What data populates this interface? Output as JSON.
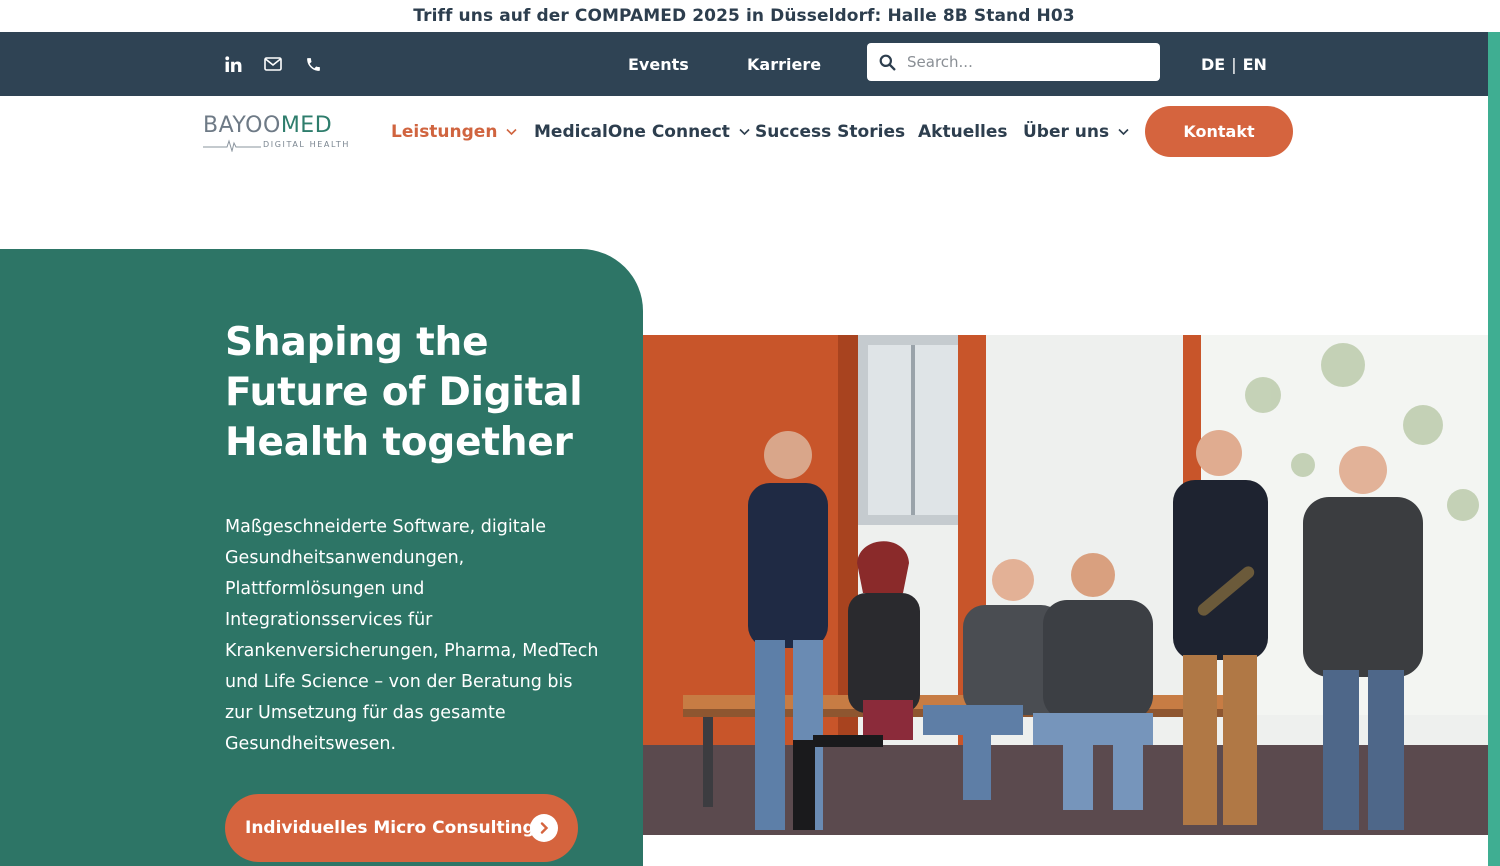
{
  "announcement": "Triff uns auf der COMPAMED 2025 in Düsseldorf: Halle 8B Stand H03",
  "topbar": {
    "links": [
      "Events",
      "Karriere"
    ],
    "search_placeholder": "Search...",
    "lang_de": "DE",
    "lang_sep": "|",
    "lang_en": "EN",
    "social_icons": [
      "linkedin-icon",
      "mail-icon",
      "phone-icon"
    ]
  },
  "logo": {
    "part1": "BAYOO",
    "part2": "MED",
    "sub": "DIGITAL HEALTH"
  },
  "nav": {
    "items": [
      {
        "label": "Leistungen",
        "has_dropdown": true,
        "active": true
      },
      {
        "label": "MedicalOne Connect",
        "has_dropdown": true,
        "active": false
      },
      {
        "label": "Success Stories",
        "has_dropdown": false,
        "active": false
      },
      {
        "label": "Aktuelles",
        "has_dropdown": false,
        "active": false
      },
      {
        "label": "Über uns",
        "has_dropdown": true,
        "active": false
      }
    ],
    "cta": "Kontakt"
  },
  "hero": {
    "title": "Shaping the Future of Digital Health together",
    "text": "Maßgeschneiderte Software, digitale Gesundheitsanwendungen, Plattformlösungen und Integrationsservices für Krankenversicherungen, Pharma, MedTech und Life Science – von der Beratung bis zur Umsetzung für das gesamte Gesundheitswesen.",
    "cta": "Individuelles Micro Consulting"
  },
  "colors": {
    "brand_dark": "#2f4354",
    "brand_green": "#2d7566",
    "accent_orange": "#d5643e",
    "edge_green": "#3fae92"
  }
}
